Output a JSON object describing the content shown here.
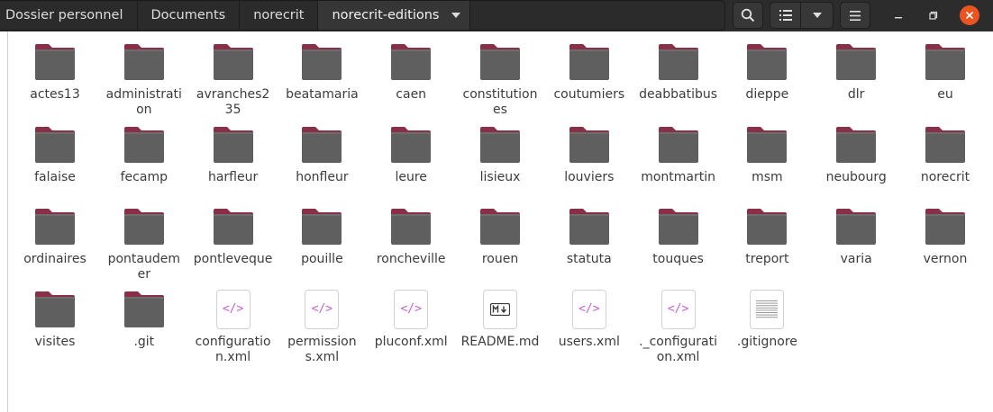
{
  "breadcrumb": {
    "items": [
      "Dossier personnel",
      "Documents",
      "norecrit",
      "norecrit-editions"
    ]
  },
  "toolbar": {
    "search_icon": "search-icon",
    "view_icon": "list-view-icon",
    "view_dropdown_icon": "chevron-down-icon",
    "menu_icon": "hamburger-menu-icon"
  },
  "window_controls": {
    "minimize_icon": "minimize-icon",
    "maximize_icon": "maximize-icon",
    "close_icon": "close-icon",
    "close_color": "#e95420"
  },
  "colors": {
    "folder_tab": "#8a2f48",
    "folder_body": "#5f5f5f",
    "xml_accent": "#c55fd6",
    "header_bg": "#2c2c2c"
  },
  "files": [
    {
      "name": "actes13",
      "type": "folder"
    },
    {
      "name": "administration",
      "type": "folder"
    },
    {
      "name": "avranches235",
      "type": "folder"
    },
    {
      "name": "beatamaria",
      "type": "folder"
    },
    {
      "name": "caen",
      "type": "folder"
    },
    {
      "name": "constitutiones",
      "type": "folder"
    },
    {
      "name": "coutumiers",
      "type": "folder"
    },
    {
      "name": "deabbatibus",
      "type": "folder"
    },
    {
      "name": "dieppe",
      "type": "folder"
    },
    {
      "name": "dlr",
      "type": "folder"
    },
    {
      "name": "eu",
      "type": "folder"
    },
    {
      "name": "falaise",
      "type": "folder"
    },
    {
      "name": "fecamp",
      "type": "folder"
    },
    {
      "name": "harfleur",
      "type": "folder"
    },
    {
      "name": "honfleur",
      "type": "folder"
    },
    {
      "name": "leure",
      "type": "folder"
    },
    {
      "name": "lisieux",
      "type": "folder"
    },
    {
      "name": "louviers",
      "type": "folder"
    },
    {
      "name": "montmartin",
      "type": "folder"
    },
    {
      "name": "msm",
      "type": "folder"
    },
    {
      "name": "neubourg",
      "type": "folder"
    },
    {
      "name": "norecrit",
      "type": "folder"
    },
    {
      "name": "ordinaires",
      "type": "folder"
    },
    {
      "name": "pontaudemer",
      "type": "folder"
    },
    {
      "name": "pontleveque",
      "type": "folder"
    },
    {
      "name": "pouille",
      "type": "folder"
    },
    {
      "name": "roncheville",
      "type": "folder"
    },
    {
      "name": "rouen",
      "type": "folder"
    },
    {
      "name": "statuta",
      "type": "folder"
    },
    {
      "name": "touques",
      "type": "folder"
    },
    {
      "name": "treport",
      "type": "folder"
    },
    {
      "name": "varia",
      "type": "folder"
    },
    {
      "name": "vernon",
      "type": "folder"
    },
    {
      "name": "visites",
      "type": "folder"
    },
    {
      "name": ".git",
      "type": "folder"
    },
    {
      "name": "configuration.xml",
      "type": "xml"
    },
    {
      "name": "permissions.xml",
      "type": "xml"
    },
    {
      "name": "pluconf.xml",
      "type": "xml"
    },
    {
      "name": "README.md",
      "type": "markdown"
    },
    {
      "name": "users.xml",
      "type": "xml"
    },
    {
      "name": "._configuration.xml",
      "type": "xml"
    },
    {
      "name": ".gitignore",
      "type": "text"
    }
  ]
}
